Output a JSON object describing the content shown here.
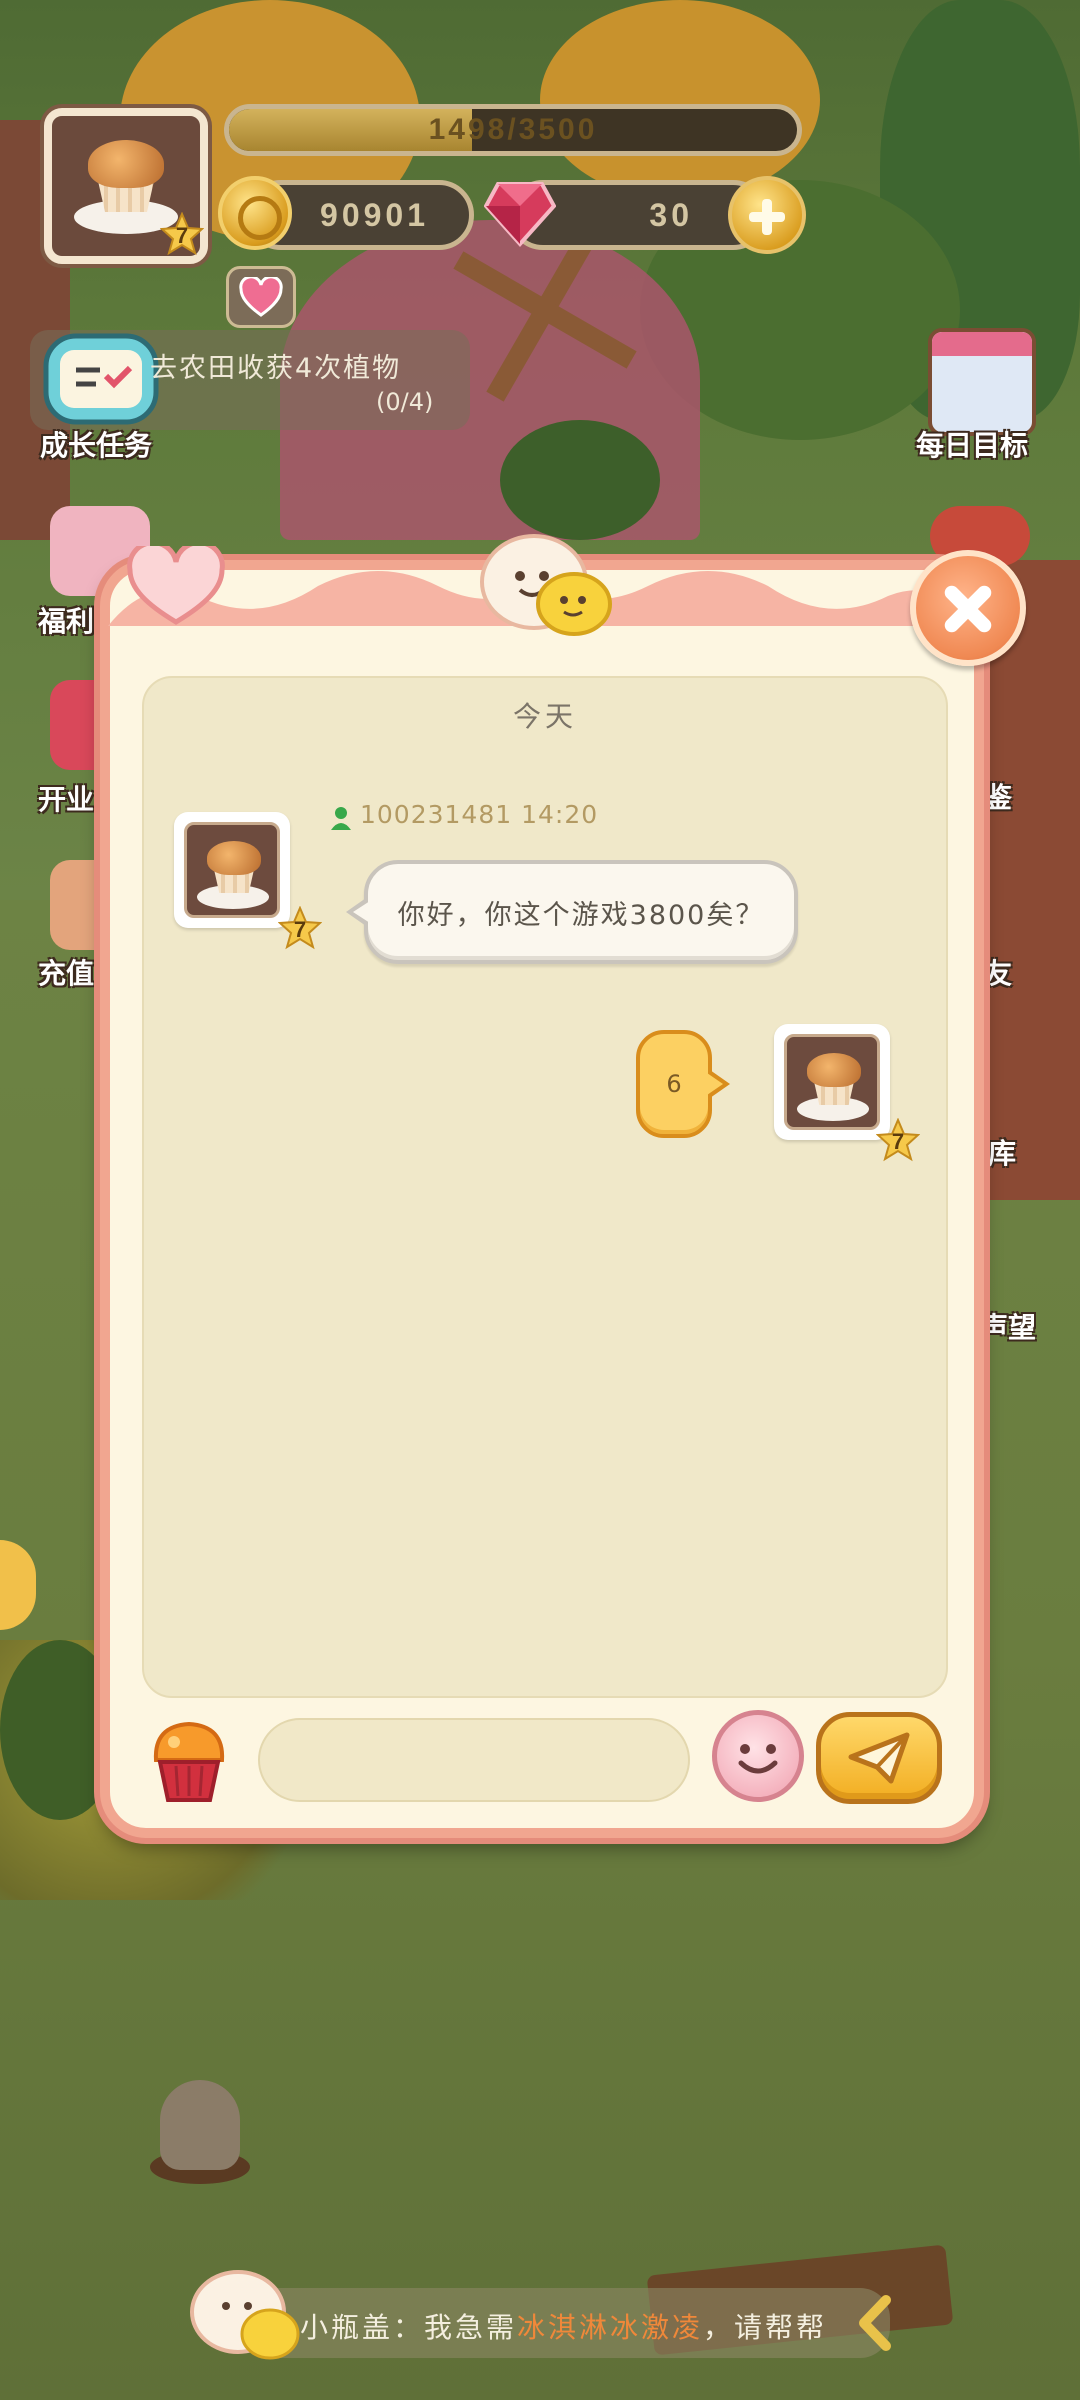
{
  "hud": {
    "level": "7",
    "xp_text": "1498/3500",
    "xp_fraction": 0.428,
    "coins": "90901",
    "gems": "30"
  },
  "task": {
    "title": "去农田收获4次植物",
    "progress": "(0/4)",
    "label": "成长任务"
  },
  "side_left": [
    "福利",
    "开业",
    "充值"
  ],
  "side_right": {
    "daily_goal": "每日目标",
    "items": [
      "鉴",
      "友",
      "库",
      "声望"
    ]
  },
  "chat": {
    "date_label": "今天",
    "messages": [
      {
        "side": "left",
        "sender": "100231481",
        "time": "14:20",
        "text": "你好，你这个游戏3800矣？",
        "level": "7"
      },
      {
        "side": "right",
        "text": "6",
        "level": "7"
      }
    ],
    "input_value": "",
    "input_placeholder": ""
  },
  "ticker": {
    "prefix": "小瓶盖：我急需",
    "highlight": "冰淇淋冰激凌",
    "suffix": "，请帮帮"
  },
  "colors": {
    "dialog_border": "#f1a690",
    "chat_bg": "#f0e8c9",
    "bubble_right": "#fcd062",
    "accent_orange": "#f08953"
  },
  "icons": [
    "muffin-avatar-icon",
    "coin-icon",
    "gem-icon",
    "plus-icon",
    "heart-icon",
    "calendar-icon",
    "close-icon",
    "smile-icon",
    "send-icon"
  ]
}
